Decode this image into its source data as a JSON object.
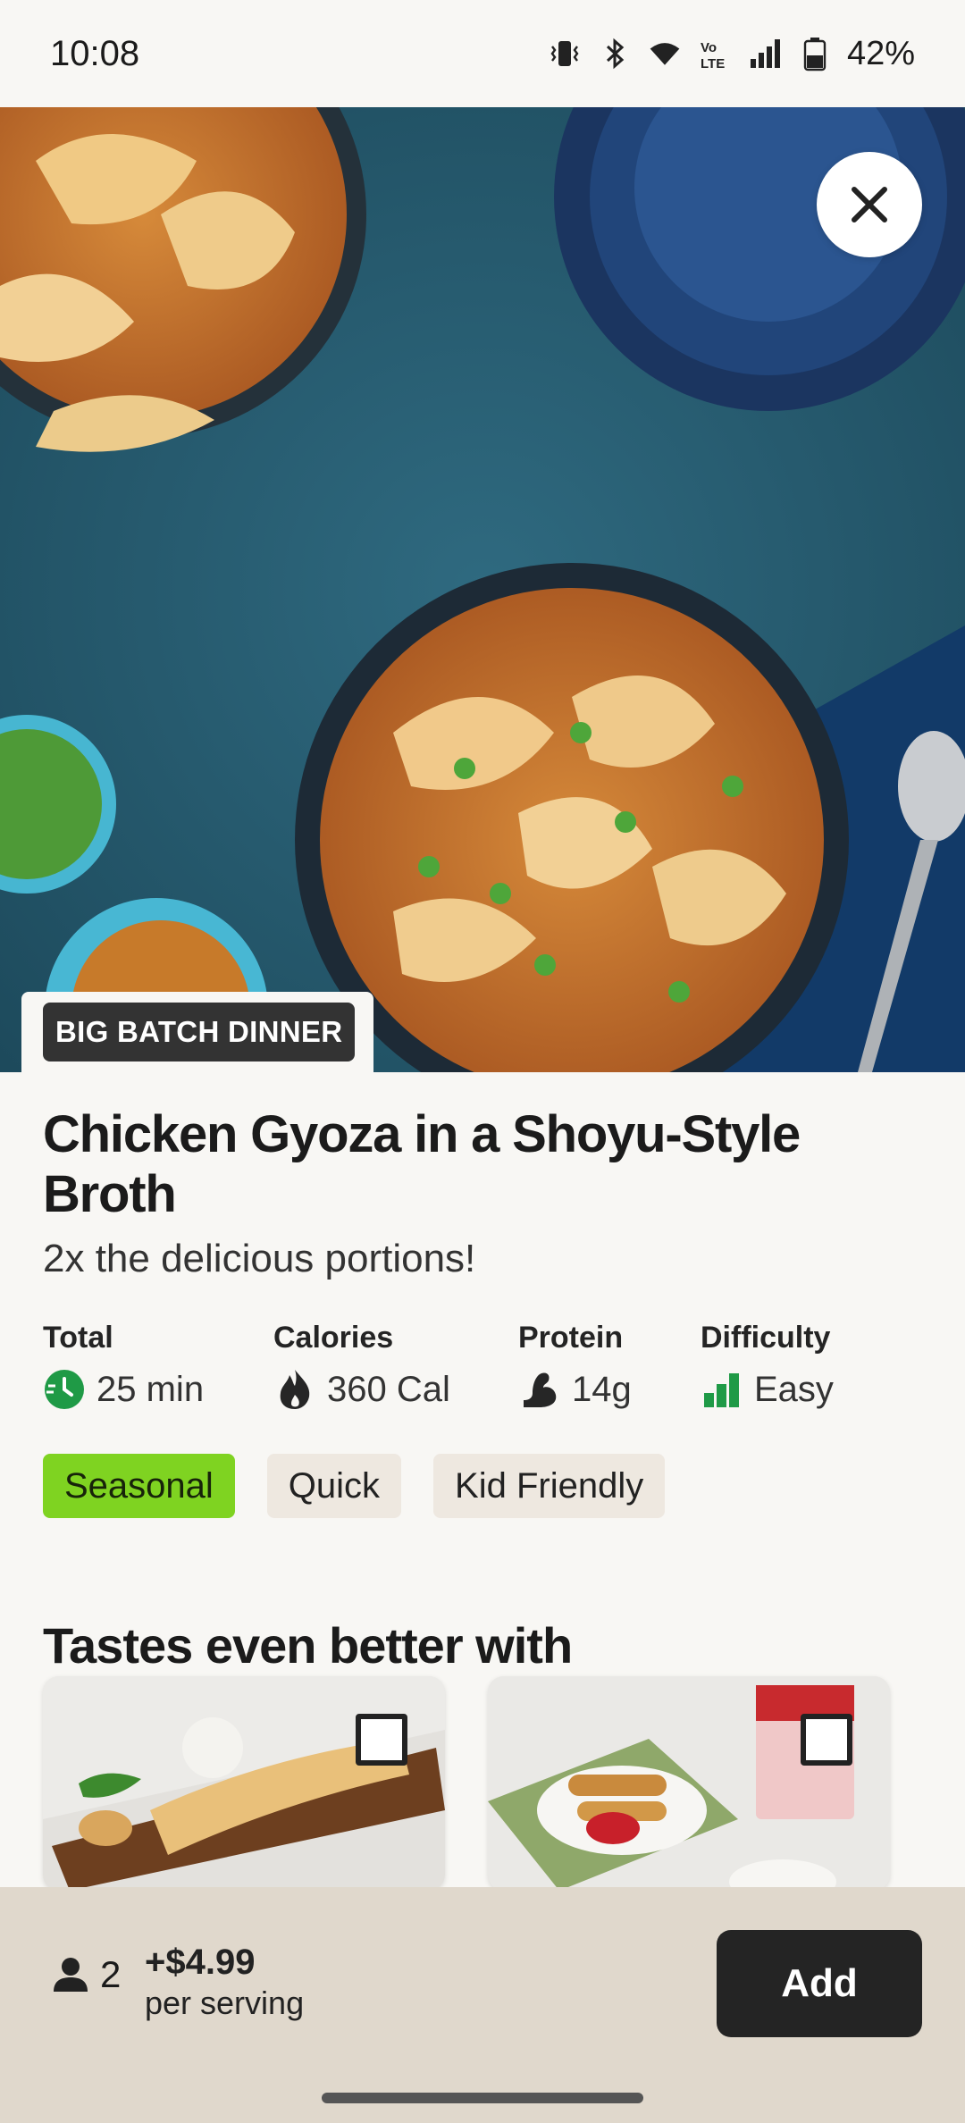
{
  "status_bar": {
    "time": "10:08",
    "battery": "42%",
    "icons": [
      "vibrate-icon",
      "bluetooth-icon",
      "wifi-icon",
      "volte-icon",
      "signal-icon",
      "battery-icon"
    ]
  },
  "hero": {
    "close_icon": "close-icon",
    "tag": "BIG BATCH DINNER"
  },
  "recipe": {
    "title": "Chicken Gyoza in a Shoyu-Style Broth",
    "subtitle": "2x the delicious portions!",
    "stats": [
      {
        "label": "Total",
        "value": "25 min",
        "icon": "clock-icon"
      },
      {
        "label": "Calories",
        "value": "360 Cal",
        "icon": "flame-icon"
      },
      {
        "label": "Protein",
        "value": "14g",
        "icon": "muscle-icon"
      },
      {
        "label": "Difficulty",
        "value": "Easy",
        "icon": "difficulty-bars-icon"
      }
    ],
    "chips": [
      "Seasonal",
      "Quick",
      "Kid Friendly"
    ]
  },
  "addons": {
    "section_title": "Tastes even better with"
  },
  "bottom_bar": {
    "servings": "2",
    "price": "+$4.99",
    "price_note": "per serving",
    "add_label": "Add"
  },
  "colors": {
    "background": "#f8f7f4",
    "seasonal_chip": "#7fd321",
    "chip": "#eee8e0",
    "bottom_bar": "#e0d8cc",
    "add_button": "#242424",
    "accent_green": "#1f9a46"
  }
}
